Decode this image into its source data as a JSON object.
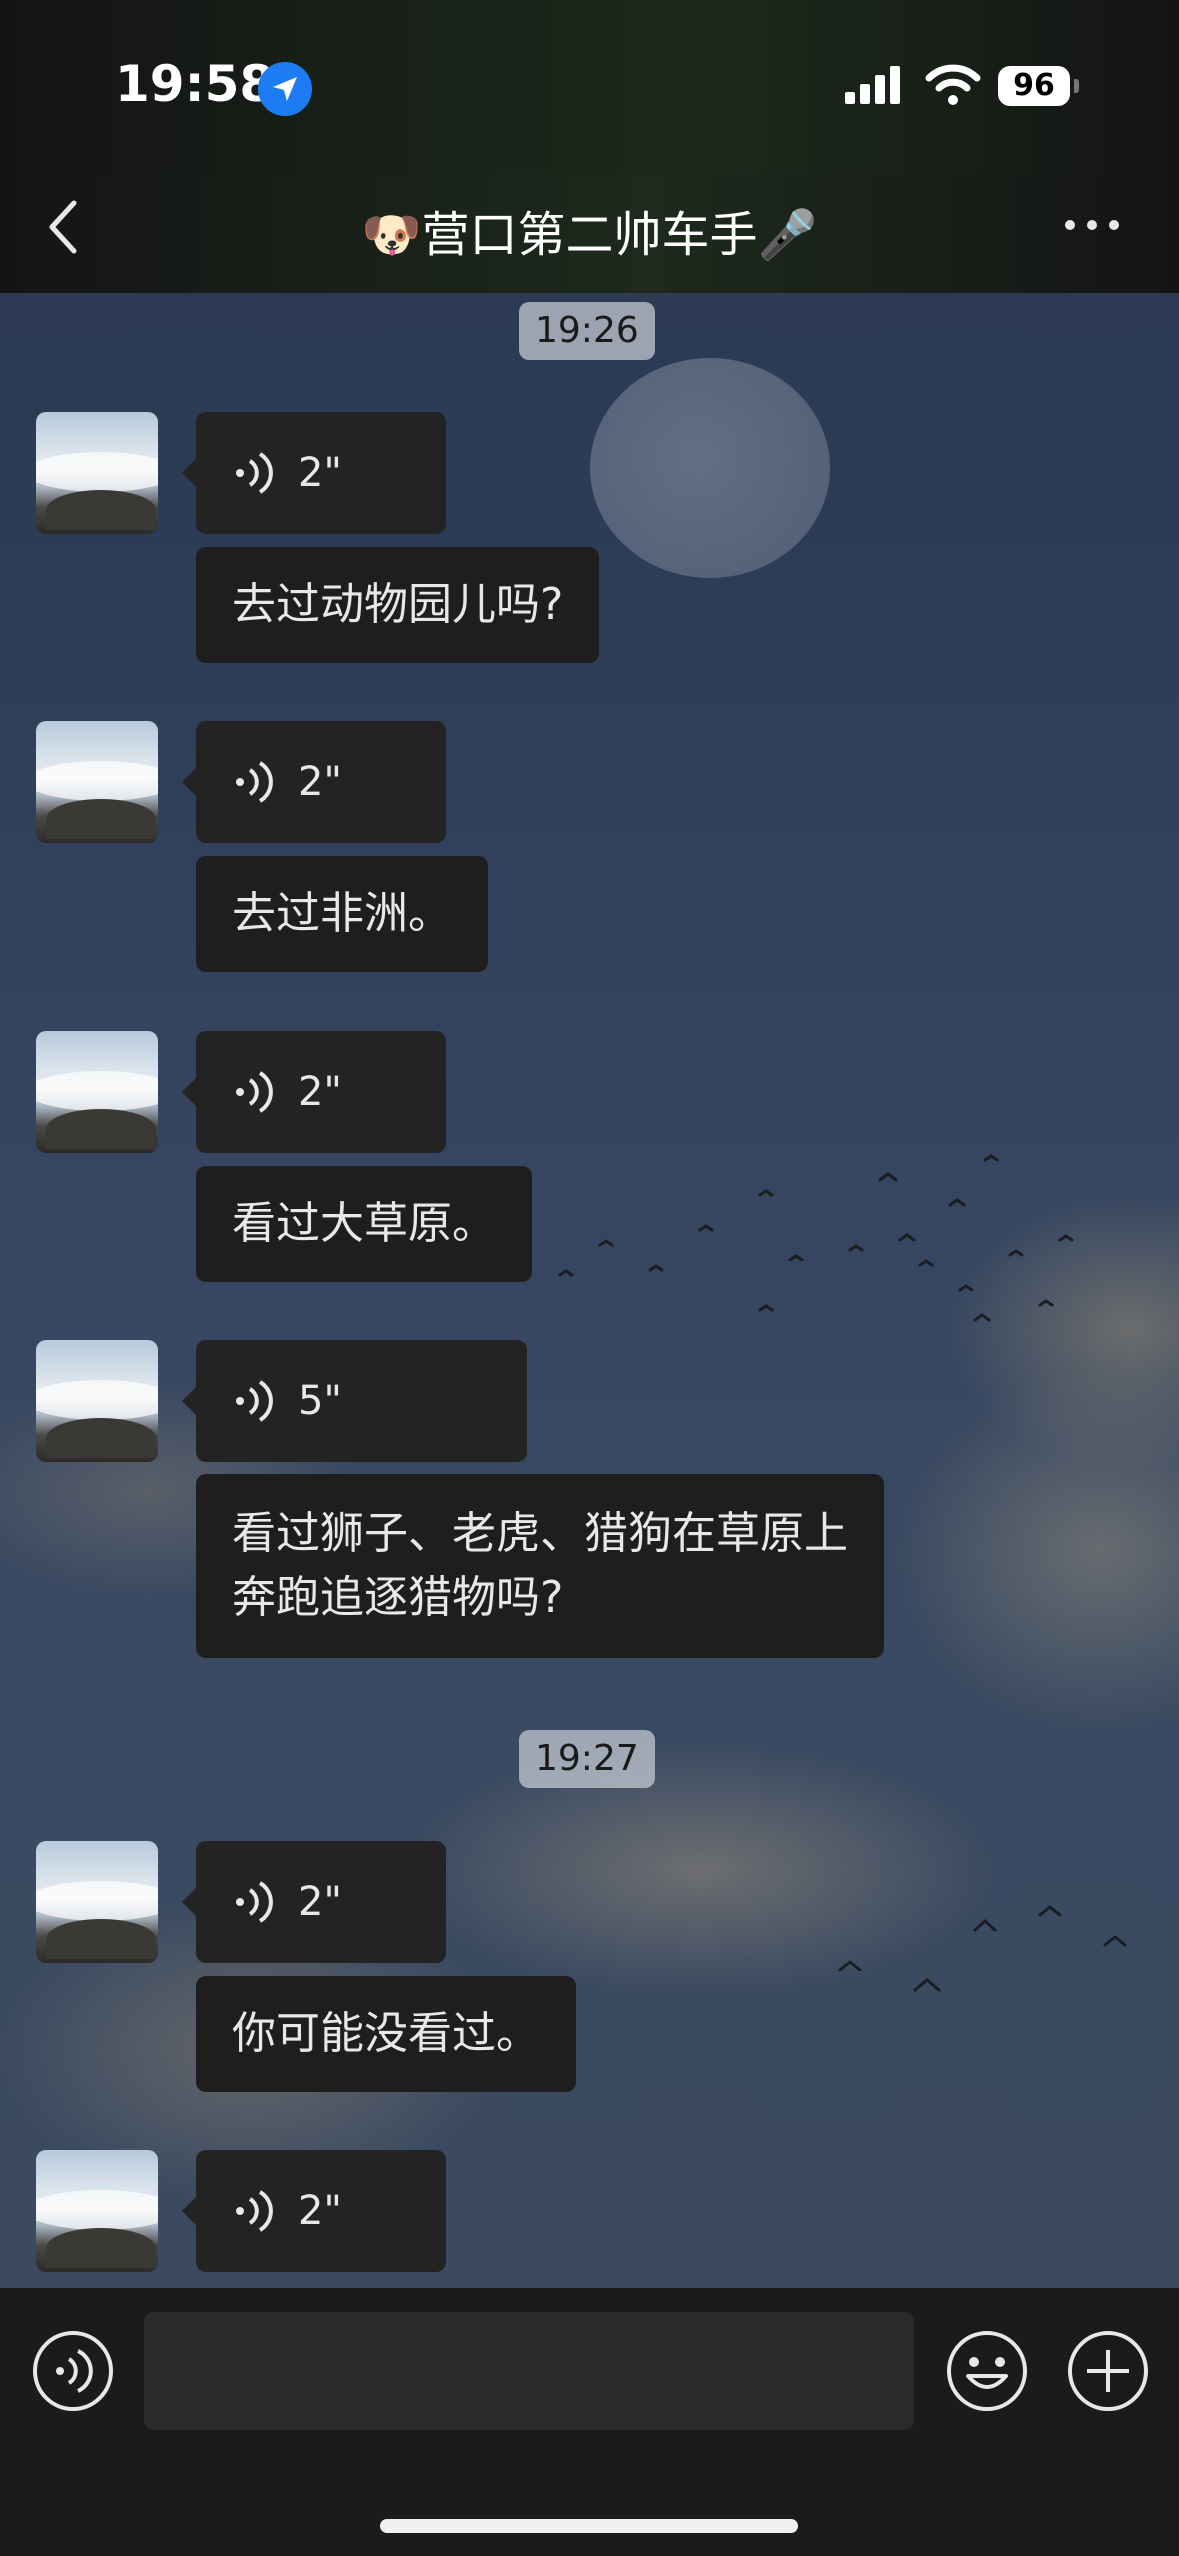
{
  "status_bar": {
    "time": "19:58",
    "battery": "96",
    "icons": [
      "location-icon",
      "signal-icon",
      "wifi-icon",
      "battery-icon"
    ]
  },
  "nav": {
    "title": "🐶营口第二帅车手🎤",
    "back_icon": "chevron-left-icon",
    "more_icon": "more-dots-icon"
  },
  "timestamps": [
    "19:26",
    "19:27"
  ],
  "messages": [
    {
      "voice": "2\"",
      "text": "去过动物园儿吗?"
    },
    {
      "voice": "2\"",
      "text": "去过非洲。"
    },
    {
      "voice": "2\"",
      "text": "看过大草原。"
    },
    {
      "voice": "5\"",
      "text_lines": [
        "看过狮子、老虎、猎狗在草原上",
        "奔跑追逐猎物吗?"
      ]
    },
    {
      "voice": "2\"",
      "text": "你可能没看过。"
    },
    {
      "voice": "2\""
    }
  ],
  "input_bar": {
    "icons": [
      "voice-input-icon",
      "emoji-icon",
      "plus-icon"
    ],
    "value": ""
  }
}
